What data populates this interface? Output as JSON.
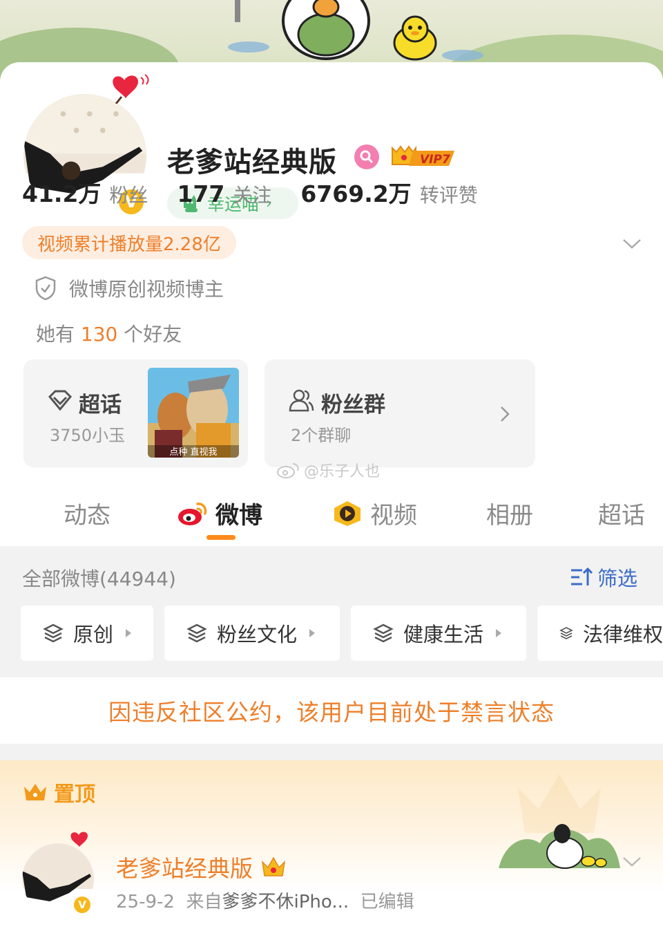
{
  "profile": {
    "name": "老爹站经典版",
    "vip_label": "VIP7",
    "lucky_label": "幸运喵",
    "stats": [
      {
        "num": "41.2万",
        "label": "粉丝"
      },
      {
        "num": "177",
        "label": "关注"
      },
      {
        "num": "6769.2万",
        "label": "转评赞"
      }
    ],
    "video_tag": "视频累计播放量2.28亿",
    "verify_text": "微博原创视频博主",
    "friends": {
      "prefix": "她有",
      "count": "130",
      "suffix": "个好友"
    }
  },
  "tiles": {
    "chaohua": {
      "title": "超话",
      "sub": "3750小玉",
      "thumb_caption": "点种 直视我"
    },
    "fans": {
      "title": "粉丝群",
      "sub": "2个群聊"
    }
  },
  "watermark": "@乐子人也",
  "tabs": [
    {
      "label": "动态"
    },
    {
      "label": "微博"
    },
    {
      "label": "视频"
    },
    {
      "label": "相册"
    },
    {
      "label": "超话"
    }
  ],
  "feed": {
    "all_label": "全部微博(44944)",
    "filter_label": "筛选",
    "chips": [
      "原创",
      "粉丝文化",
      "健康生活",
      "法律维权"
    ],
    "ban_notice": "因违反社区公约，该用户目前处于禁言状态"
  },
  "pinned": {
    "label": "置顶",
    "author": "老爹站经典版",
    "date": "25-9-2",
    "source_prefix": "来自",
    "source": "爹爹不休iPho...",
    "edited": "已编辑"
  },
  "colors": {
    "accent_orange": "#ee7f2a",
    "link_blue": "#3b6cc8",
    "lucky_green": "#4fb870",
    "vip_gold": "#f6b81b"
  }
}
